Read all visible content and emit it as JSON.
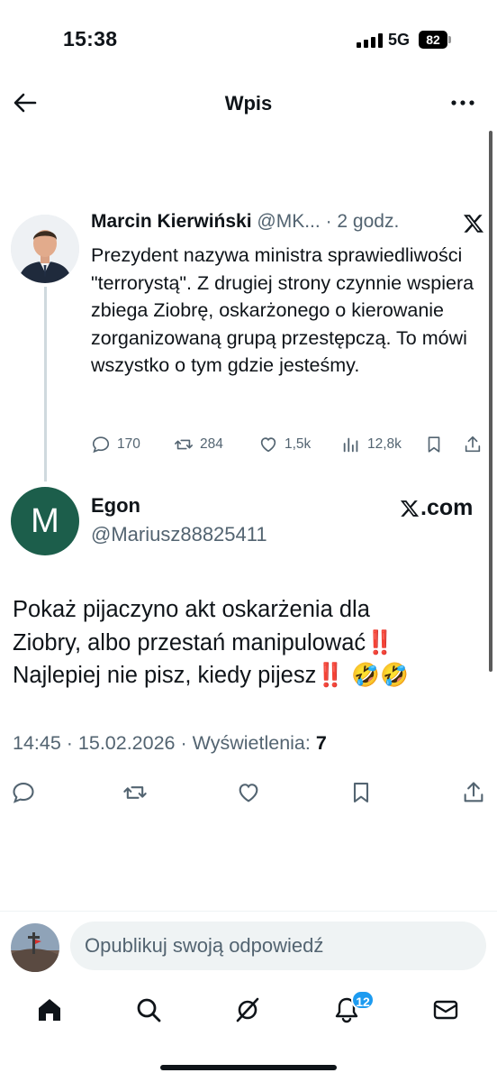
{
  "status_bar": {
    "time": "15:38",
    "network": "5G",
    "battery": "82"
  },
  "header": {
    "title": "Wpis"
  },
  "parent_tweet": {
    "name": "Marcin Kierwiński",
    "handle": "@MK...",
    "time_separator": "·",
    "time": "2 godz.",
    "text": "Prezydent nazywa  ministra sprawiedliwości \"terrorystą\". Z drugiej strony czynnie wspiera zbiega Ziobrę, oskarżonego o kierowanie zorganizowaną grupą przestępczą. To mówi wszystko o tym gdzie jesteśmy.",
    "replies": "170",
    "reposts": "284",
    "likes": "1,5k",
    "views": "12,8k"
  },
  "main_tweet": {
    "avatar_letter": "M",
    "name": "Egon",
    "handle": "@Mariusz88825411",
    "source_label": ".com",
    "text_line1": "Pokaż pijaczyno akt oskarżenia dla",
    "text_line2": "Ziobry, albo przestań manipulować",
    "text_line3": "Najlepiej nie pisz, kiedy pijesz",
    "emphasis": "‼️",
    "emoji": "🤣🤣",
    "timestamp": "14:45 · 15.02.2026 · Wyświetlenia: ",
    "views": "7"
  },
  "reply_bar": {
    "placeholder": "Opublikuj swoją odpowiedź"
  },
  "tab_bar": {
    "notifications_badge": "12"
  },
  "colors": {
    "accent": "#1d9bf0",
    "text": "#0f1419",
    "secondary": "#536471",
    "avatar_bg": "#1c5e4b"
  }
}
